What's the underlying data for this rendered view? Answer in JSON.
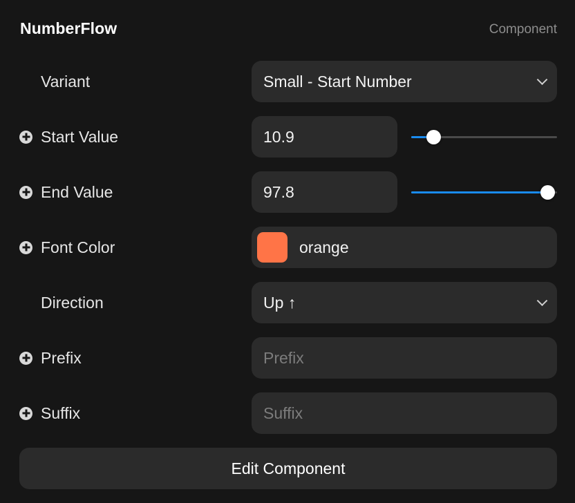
{
  "header": {
    "title": "NumberFlow",
    "tag": "Component"
  },
  "variant": {
    "label": "Variant",
    "value": "Small - Start Number"
  },
  "start_value": {
    "label": "Start Value",
    "value": "10.9",
    "slider_fraction": 0.15
  },
  "end_value": {
    "label": "End Value",
    "value": "97.8",
    "slider_fraction": 0.935
  },
  "font_color": {
    "label": "Font Color",
    "value": "orange",
    "swatch_color": "#ff7447"
  },
  "direction": {
    "label": "Direction",
    "value": "Up ↑"
  },
  "prefix": {
    "label": "Prefix",
    "placeholder": "Prefix"
  },
  "suffix": {
    "label": "Suffix",
    "placeholder": "Suffix"
  },
  "edit_button": {
    "label": "Edit Component"
  },
  "colors": {
    "background": "#161616",
    "field": "#2b2b2b",
    "accent": "#1a8cf0"
  },
  "icons": {
    "add": "plus-circle-icon",
    "dropdown": "chevron-down-icon"
  }
}
